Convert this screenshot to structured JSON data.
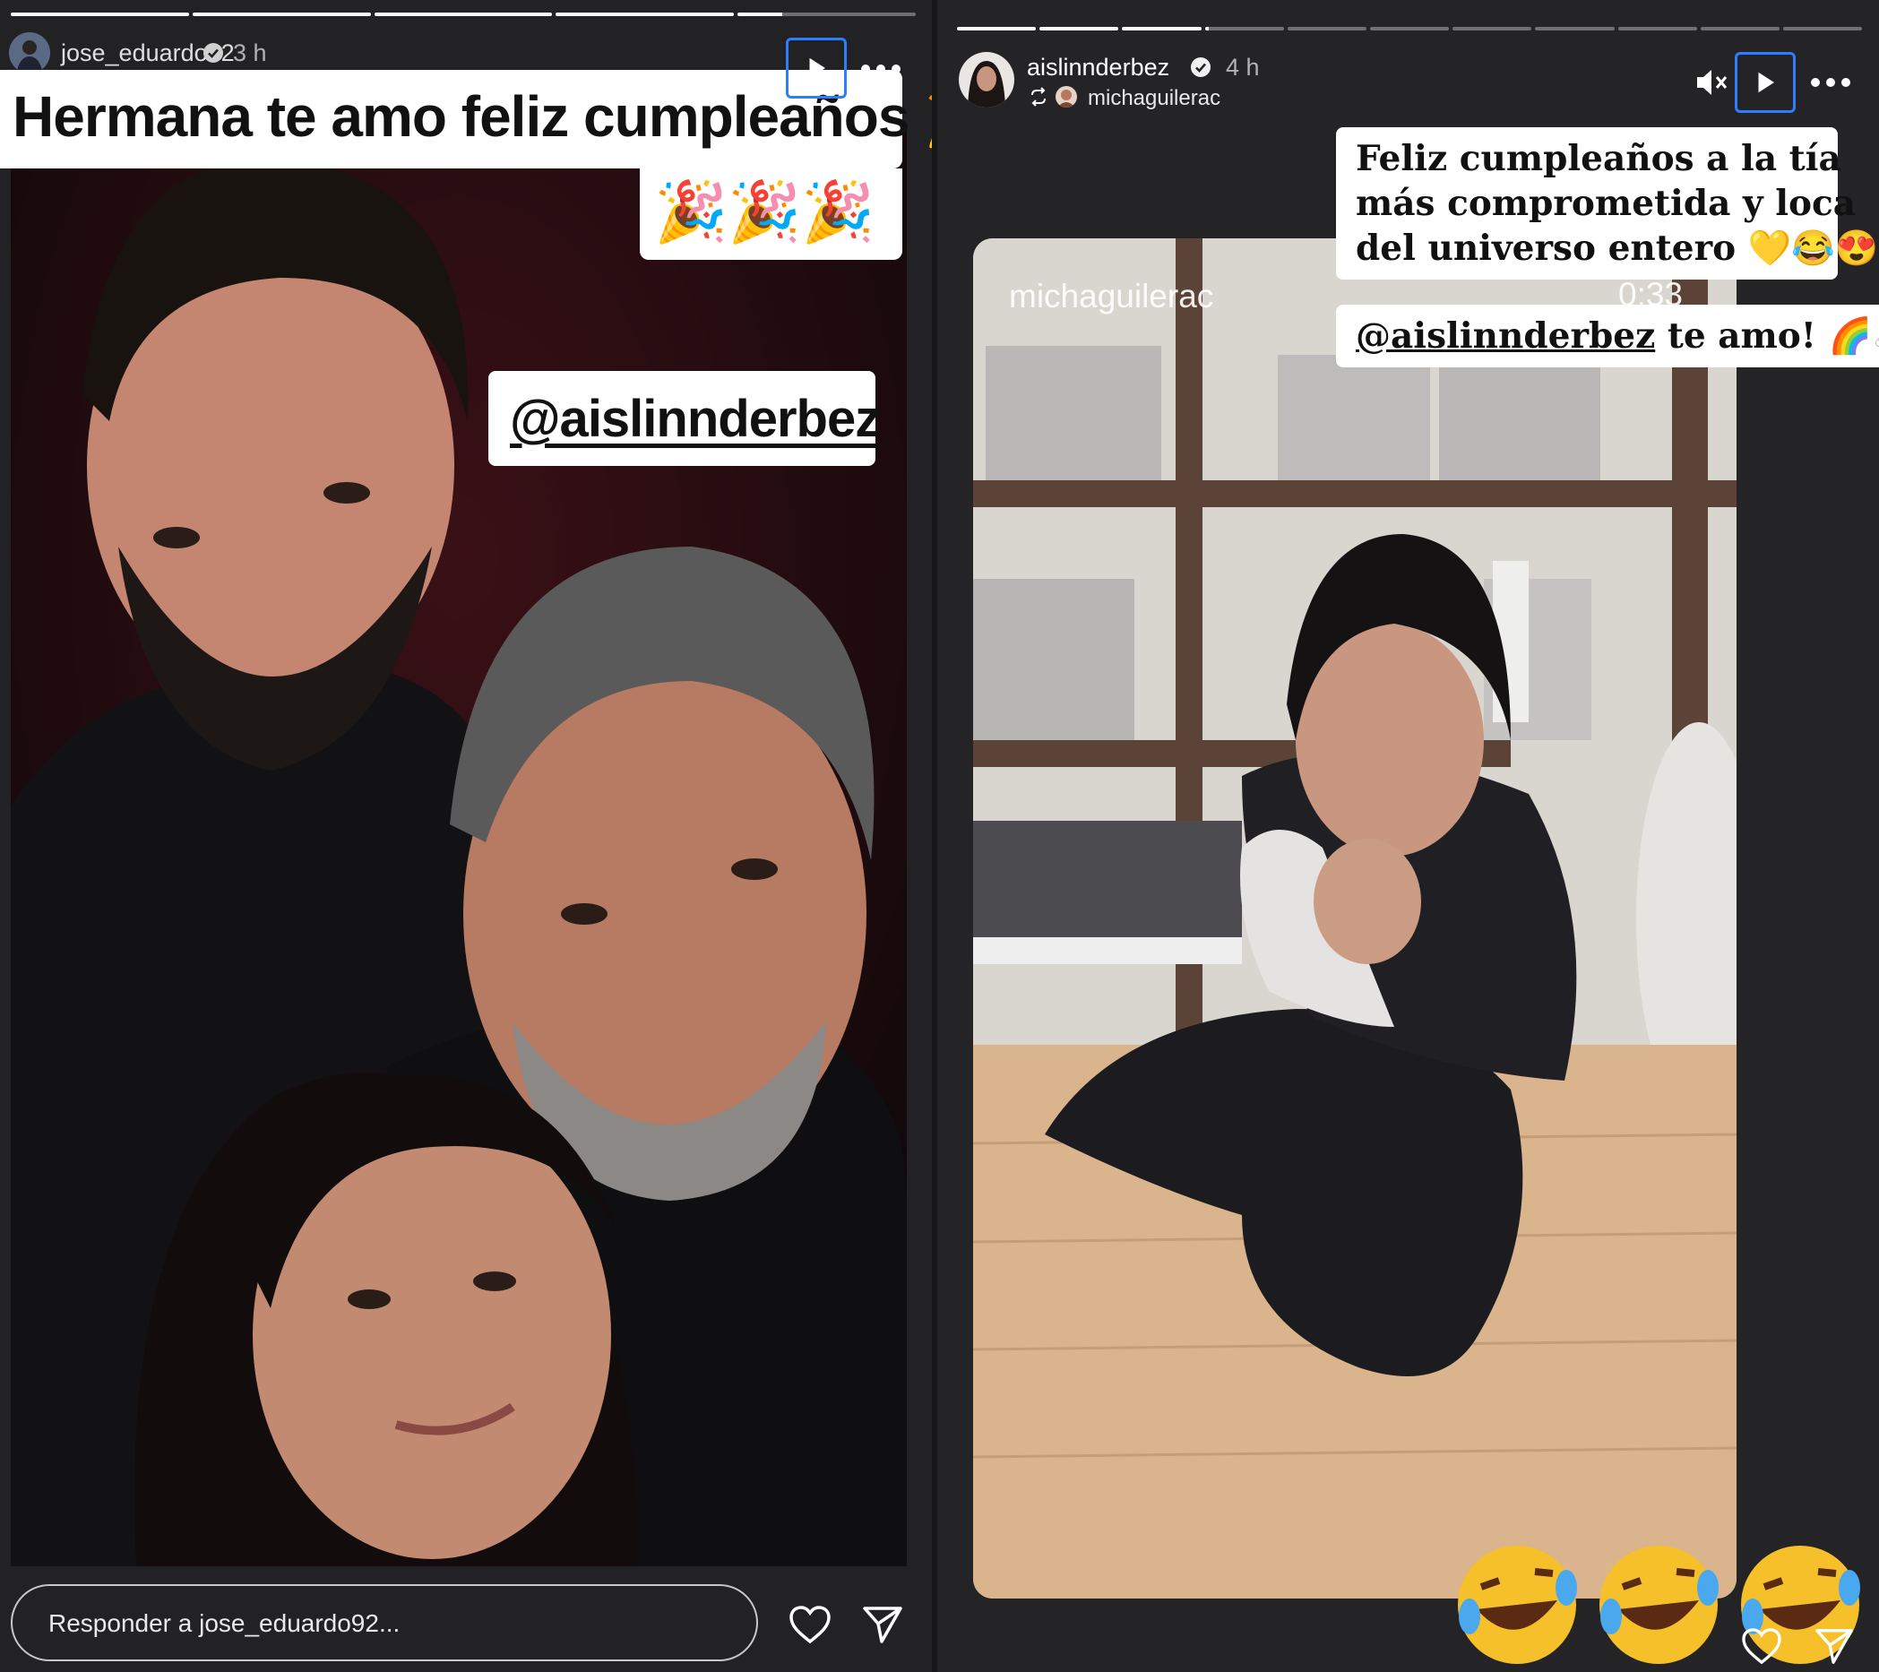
{
  "left_story": {
    "username": "jose_eduardo92",
    "time": "3 h",
    "caption_main": "Hermana te amo feliz cumpleaños 🎉",
    "caption_emojis": "🎉🎉🎉",
    "mention": "@aislinnderbez",
    "reply_placeholder": "Responder a jose_eduardo92...",
    "progress": [
      1,
      1,
      1,
      1,
      0.25
    ],
    "icons": [
      "verified-badge-icon",
      "play-icon",
      "more-icon",
      "heart-icon",
      "send-icon"
    ]
  },
  "right_story": {
    "username": "aislinnderbez",
    "time": "4 h",
    "reshared_from": "michaguilerac",
    "watermark_user": "michaguilerac",
    "video_time": "0:33",
    "caption_lines": [
      "Feliz cumpleaños a la tía",
      "más comprometida y loca",
      "del universo entero 💛😂😍"
    ],
    "mention": "@aislinnderbez",
    "mention_suffix": " te amo! 🌈🦄",
    "progress": [
      1,
      1,
      1,
      0.05,
      0,
      0,
      0,
      0,
      0,
      0,
      0
    ],
    "icons": [
      "verified-badge-icon",
      "reshare-icon",
      "muted-icon",
      "play-icon",
      "more-icon",
      "laughing-emoji-icon",
      "heart-icon",
      "send-icon"
    ]
  },
  "colors": {
    "background": "#222225",
    "accent_focus": "#2f7dff",
    "caption_bg": "#ffffff",
    "caption_text": "#111111"
  }
}
